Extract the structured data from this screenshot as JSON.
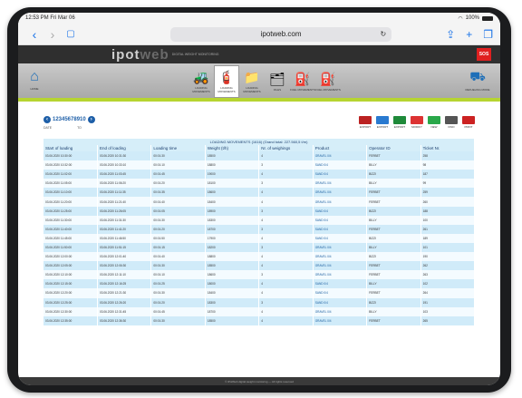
{
  "status": {
    "time": "12:53 PM  Fri Mar 06",
    "battery": "100%"
  },
  "browser": {
    "url": "ipotweb.com",
    "back": "‹",
    "forward": "›",
    "reload": "↻"
  },
  "app": {
    "logo_main": "ipot",
    "logo_web": "web",
    "logo_sub": "DIGITAL WEIGHT MONITORING",
    "sos": "SOS",
    "home_label": "HOME",
    "toolbar": [
      {
        "icon": "loader-icon",
        "glyph": "🚜",
        "label": "LOADING MOVEMENTS"
      },
      {
        "icon": "extinguisher-icon",
        "glyph": "🧯",
        "label": "LOADING MOVEMENTS",
        "active": true
      },
      {
        "icon": "folder-icon",
        "glyph": "📁",
        "label": "LOADING MOVEMENTS"
      },
      {
        "icon": "folders-icon",
        "glyph": "🗂",
        "label": "FILES"
      },
      {
        "icon": "fuel-truck-icon",
        "glyph": "⛽",
        "label": "FUEL MOVEMENTS"
      },
      {
        "icon": "fuel-pump-icon",
        "glyph": "⛽",
        "label": "FUEL MOVEMENTS"
      }
    ],
    "right_label": "REFUELING MODE"
  },
  "pager": {
    "pages": "12345678910",
    "from_label": "DATE",
    "to_label": "TO"
  },
  "actions": [
    {
      "name": "edit-icon",
      "color": "#b22",
      "label": "EXPORT"
    },
    {
      "name": "export-icon",
      "color": "#2a7ad0",
      "label": "EXPORT"
    },
    {
      "name": "excel-icon",
      "color": "#1f8a3a",
      "label": "EXPORT"
    },
    {
      "name": "pencil-icon",
      "color": "#d33",
      "label": "MODIFY"
    },
    {
      "name": "add-icon",
      "color": "#2aa84a",
      "label": "NEW"
    },
    {
      "name": "search-icon",
      "color": "#555",
      "label": "FIND"
    },
    {
      "name": "print-icon",
      "color": "#c22",
      "label": "PRINT"
    }
  ],
  "table": {
    "caption": "LOADING MOVEMENTS (1616) (Grand total: 227.560,5 t/m)",
    "headers": [
      "Start of loading",
      "End of loading",
      "Loading time",
      "Weight (t/h)",
      "Nr. of weighings",
      "Product",
      "Operator ID",
      "Ticket Nr."
    ],
    "rows": [
      [
        "03.06.2020 10:30:00",
        "03.06.2020 10:31:30",
        "00:01:30",
        "18500",
        "4",
        "GRAVEL 0/4",
        "FERBET",
        "258"
      ],
      [
        "03.06.2020 10:32:00",
        "03.06.2020 10:33:10",
        "00:01:10",
        "18800",
        "3",
        "SAND 0/4",
        "BILLY",
        "98"
      ],
      [
        "03.06.2020 11:02:00",
        "03.06.2020 11:03:45",
        "00:01:45",
        "19000",
        "4",
        "SAND 0/4",
        "BIZZI",
        "187"
      ],
      [
        "03.06.2020 11:05:00",
        "03.06.2020 11:06:20",
        "00:01:20",
        "18100",
        "3",
        "GRAVEL 0/4",
        "BILLY",
        "99"
      ],
      [
        "03.06.2020 11:10:00",
        "03.06.2020 11:11:35",
        "00:01:35",
        "18600",
        "4",
        "GRAVEL 0/4",
        "FERBET",
        "259"
      ],
      [
        "03.06.2020 11:20:00",
        "03.06.2020 11:21:40",
        "00:01:40",
        "18400",
        "4",
        "GRAVEL 0/4",
        "FERBET",
        "260"
      ],
      [
        "03.06.2020 11:25:00",
        "03.06.2020 11:26:05",
        "00:01:05",
        "18900",
        "3",
        "SAND 0/4",
        "BIZZI",
        "188"
      ],
      [
        "03.06.2020 11:30:00",
        "03.06.2020 11:31:30",
        "00:01:30",
        "18300",
        "4",
        "SAND 0/4",
        "BILLY",
        "100"
      ],
      [
        "03.06.2020 11:40:00",
        "03.06.2020 11:41:20",
        "00:01:20",
        "18700",
        "3",
        "SAND 0/4",
        "FERBET",
        "261"
      ],
      [
        "03.06.2020 11:45:00",
        "03.06.2020 11:46:50",
        "00:01:50",
        "17900",
        "4",
        "SAND 0/4",
        "BIZZI",
        "189"
      ],
      [
        "03.06.2020 11:50:00",
        "03.06.2020 11:51:15",
        "00:01:15",
        "18200",
        "3",
        "GRAVEL 0/4",
        "BILLY",
        "101"
      ],
      [
        "03.06.2020 12:00:00",
        "03.06.2020 12:01:40",
        "00:01:40",
        "18800",
        "4",
        "GRAVEL 0/4",
        "BIZZI",
        "190"
      ],
      [
        "03.06.2020 12:05:00",
        "03.06.2020 12:06:30",
        "00:01:30",
        "18500",
        "4",
        "GRAVEL 0/4",
        "FERBET",
        "262"
      ],
      [
        "03.06.2020 12:10:00",
        "03.06.2020 12:11:10",
        "00:01:10",
        "18600",
        "3",
        "GRAVEL 0/4",
        "FERBET",
        "263"
      ],
      [
        "03.06.2020 12:15:00",
        "03.06.2020 12:16:25",
        "00:01:25",
        "18000",
        "4",
        "SAND 0/4",
        "BILLY",
        "102"
      ],
      [
        "03.06.2020 12:20:00",
        "03.06.2020 12:21:30",
        "00:01:30",
        "18400",
        "4",
        "SAND 0/4",
        "FERBET",
        "264"
      ],
      [
        "03.06.2020 12:25:00",
        "03.06.2020 12:26:20",
        "00:01:20",
        "18300",
        "3",
        "SAND 0/4",
        "BIZZI",
        "191"
      ],
      [
        "03.06.2020 12:30:00",
        "03.06.2020 12:31:45",
        "00:01:45",
        "18700",
        "4",
        "GRAVEL 0/4",
        "BILLY",
        "103"
      ],
      [
        "03.06.2020 12:35:00",
        "03.06.2020 12:36:30",
        "00:01:30",
        "18500",
        "4",
        "GRAVEL 0/4",
        "FERBET",
        "265"
      ]
    ]
  },
  "footer": "© iPotWeb digital weight monitoring — All rights reserved"
}
